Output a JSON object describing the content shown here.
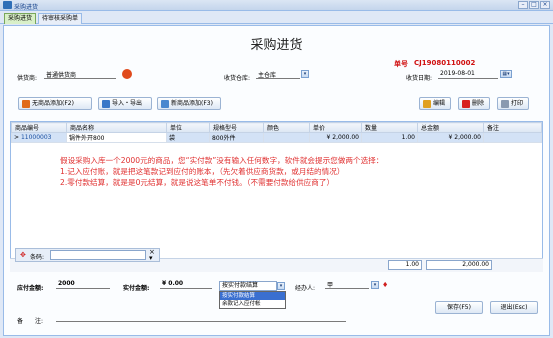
{
  "window": {
    "title": "采购进货"
  },
  "tabs": [
    {
      "label": "采购进货"
    },
    {
      "label": "待审核采购单"
    }
  ],
  "form": {
    "title": "采购进货",
    "order_no_label": "单号",
    "order_no": "CJ19080110002",
    "supplier_label": "供货商:",
    "supplier_value": "普通供货商",
    "warehouse_label": "收货仓库:",
    "warehouse_value": "主仓库",
    "date_label": "收货日期:",
    "date_value": "2019-08-01"
  },
  "toolbar": {
    "no_product_add": "无商品添加(F2)",
    "import_export": "导入・导出",
    "new_product_add": "新商品添加(F3)",
    "edit": "编辑",
    "delete": "删除",
    "print": "打印"
  },
  "table": {
    "columns": [
      "商品编号",
      "商品名称",
      "单位",
      "规格型号",
      "颜色",
      "单价",
      "数量",
      "总金额",
      "备注"
    ],
    "rows": [
      {
        "marker": ">",
        "code": "11000003",
        "name": "锅件外开800",
        "unit": "袋",
        "spec": "800外件",
        "color": "",
        "price": "¥ 2,000.00",
        "qty": "1.00",
        "total": "¥ 2,000.00",
        "remark": ""
      }
    ],
    "sum_qty": "1.00",
    "sum_total": "2,000.00"
  },
  "annotation": {
    "line1": "假设采购入库一个2000元的商品，您“实付款”没有输入任何数字，软件就会提示您做两个选择：",
    "line2": "1.记入应付账，就是把这笔款记到应付的账本，（先欠着供应商货款，或月结的情况）",
    "line3": "2.零付款结算，就是是0元结算，就是说这笔单不付钱。（不需要付款给供应商了）"
  },
  "barcode": {
    "label": "条码:",
    "value": ""
  },
  "footer": {
    "payable_label": "应付金额:",
    "payable_value": "2000",
    "paid_label": "实付金额:",
    "paid_value": "¥ 0.00",
    "settle_select": "按实付款结算",
    "settle_options": [
      "按实付款结算",
      "余款记入应付帐"
    ],
    "handler_label": "经办人:",
    "handler_value": "甲",
    "remark_label": "备　　注:",
    "remark_value": "",
    "save": "保存(F5)",
    "exit": "退出(Esc)"
  },
  "colors": {
    "title_red": "#d01010",
    "note_red": "#e03030",
    "selected_row": "#d3e2f6",
    "popup_highlight": "#3a6fd0"
  }
}
